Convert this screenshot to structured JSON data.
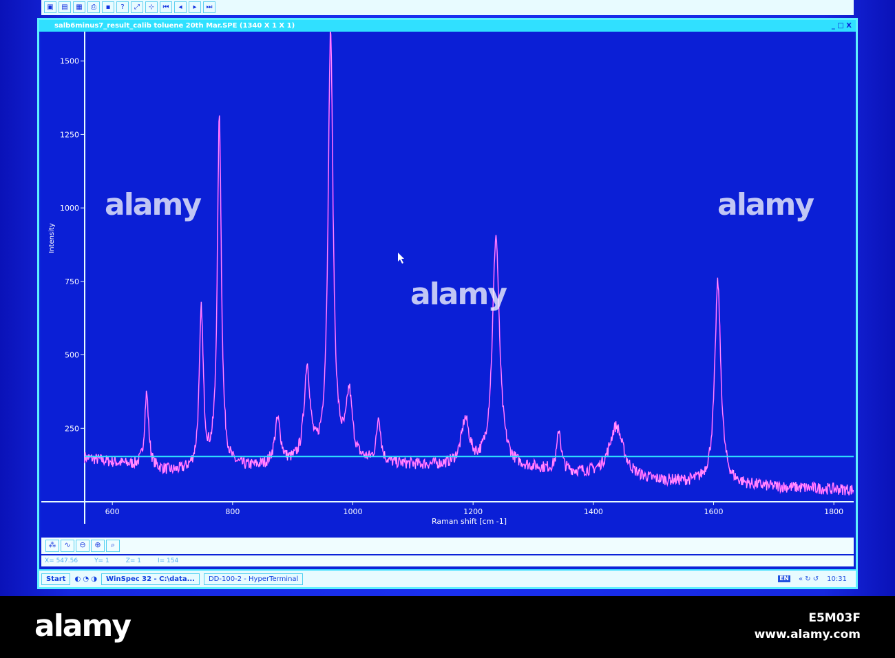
{
  "toolbar": {
    "icons": [
      "new",
      "open",
      "save",
      "print",
      "help",
      "zoom",
      "cursor",
      "first",
      "prev",
      "next",
      "last"
    ]
  },
  "window": {
    "title": "salb6minus7_result_calib toluene 20th Mar.SPE (1340 X 1 X 1)",
    "controls": "_ □ X"
  },
  "status": {
    "x": "X= 547.56",
    "y": "Y= 1",
    "z": "Z= 1",
    "i": "I= 154"
  },
  "taskbar": {
    "start": "Start",
    "task1": "WinSpec 32 - C:\\data...",
    "task2": "DD-100-2 - HyperTerminal",
    "lang": "EN",
    "time": "10:31"
  },
  "watermark": {
    "logo": "alamy",
    "code": "E5M03F",
    "url": "www.alamy.com"
  },
  "colors": {
    "trace": "#ff40ff",
    "axis": "#e8fbff",
    "cursor_line": "#30e8ff"
  },
  "chart_data": {
    "type": "line",
    "title": "",
    "xlabel": "Raman shift [cm -1]",
    "ylabel": "Intensity",
    "xlim": [
      554,
      1833
    ],
    "ylim": [
      0,
      1600
    ],
    "xticks": [
      600,
      800,
      1000,
      1200,
      1400,
      1600,
      1800
    ],
    "yticks": [
      250,
      500,
      750,
      1000,
      1250,
      1500
    ],
    "cursor_intensity": 154,
    "baseline": [
      [
        554,
        150
      ],
      [
        700,
        100
      ],
      [
        1000,
        130
      ],
      [
        1300,
        110
      ],
      [
        1500,
        70
      ],
      [
        1700,
        50
      ],
      [
        1833,
        40
      ]
    ],
    "peaks": [
      {
        "x": 657,
        "height": 367,
        "width": 4
      },
      {
        "x": 748,
        "height": 640,
        "width": 4
      },
      {
        "x": 778,
        "height": 1305,
        "width": 4
      },
      {
        "x": 875,
        "height": 270,
        "width": 6
      },
      {
        "x": 924,
        "height": 443,
        "width": 6
      },
      {
        "x": 963,
        "height": 1590,
        "width": 5
      },
      {
        "x": 994,
        "height": 350,
        "width": 6
      },
      {
        "x": 1043,
        "height": 283,
        "width": 4
      },
      {
        "x": 1187,
        "height": 270,
        "width": 8
      },
      {
        "x": 1238,
        "height": 900,
        "width": 7
      },
      {
        "x": 1343,
        "height": 240,
        "width": 4
      },
      {
        "x": 1438,
        "height": 255,
        "width": 14
      },
      {
        "x": 1607,
        "height": 744,
        "width": 6
      }
    ]
  }
}
